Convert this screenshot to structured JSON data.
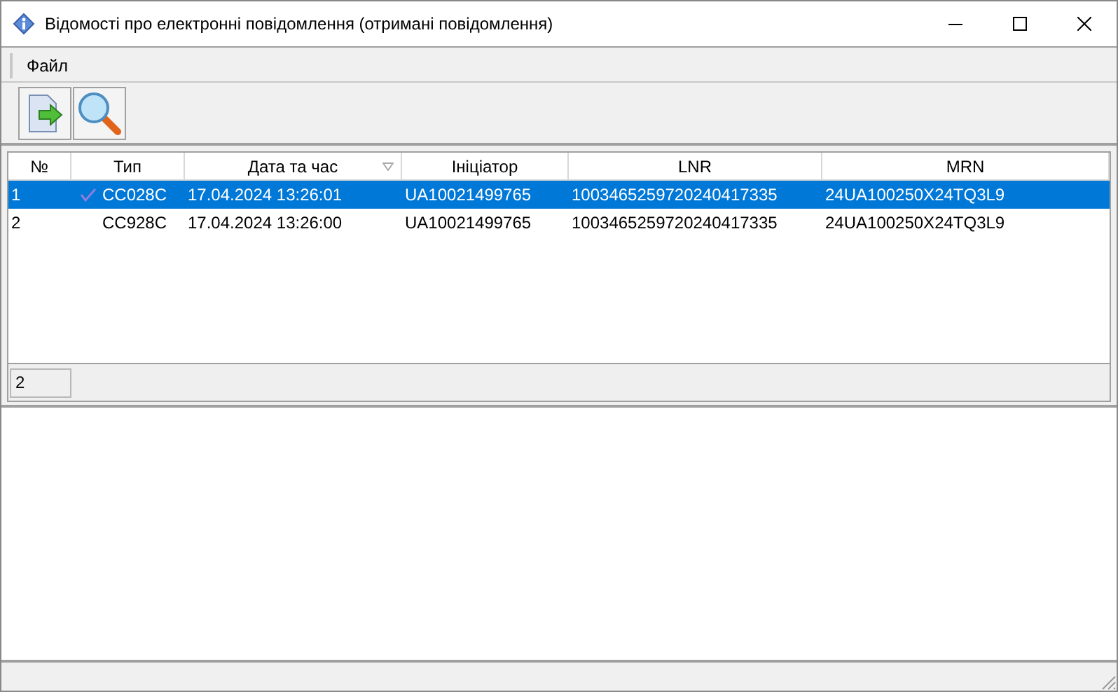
{
  "window": {
    "title": "Відомості про електронні повідомлення (отримані повідомлення)"
  },
  "menu": [
    {
      "label": "Файл"
    }
  ],
  "table": {
    "columns": [
      {
        "label": "№",
        "sorted": false
      },
      {
        "label": "Тип",
        "sorted": false
      },
      {
        "label": "Дата та час",
        "sorted": true
      },
      {
        "label": "Ініціатор",
        "sorted": false
      },
      {
        "label": "LNR",
        "sorted": false
      },
      {
        "label": "MRN",
        "sorted": false
      }
    ],
    "rows": [
      {
        "selected": true,
        "marked": true,
        "cells": [
          "1",
          "CC028C",
          "17.04.2024 13:26:01",
          "UA10021499765",
          "1003465259720240417335",
          "24UA100250X24TQ3L9"
        ]
      },
      {
        "selected": false,
        "marked": false,
        "cells": [
          "2",
          "CC928C",
          "17.04.2024 13:26:00",
          "UA10021499765",
          "1003465259720240417335",
          "24UA100250X24TQ3L9"
        ]
      }
    ]
  },
  "record_count": "2"
}
